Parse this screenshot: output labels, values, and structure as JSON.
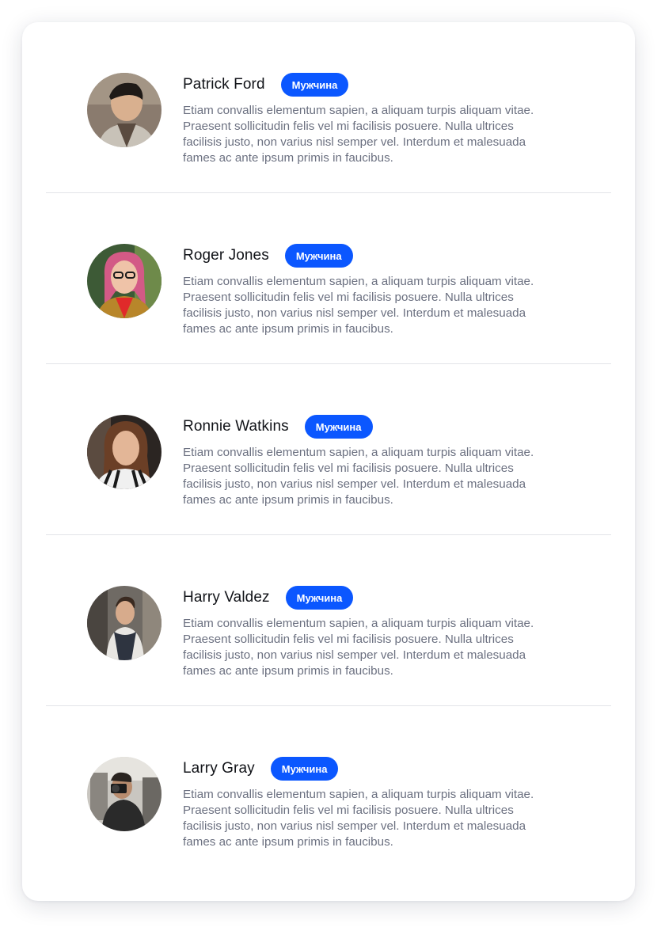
{
  "people": [
    {
      "name": "Patrick Ford",
      "badge": "Мужчина",
      "description": "Etiam convallis elementum sapien, a aliquam turpis aliquam vitae. Praesent sollicitudin felis vel mi facilisis posuere. Nulla ultrices facilisis justo, non varius nisl semper vel. Interdum et malesuada fames ac ante ipsum primis in faucibus."
    },
    {
      "name": "Roger Jones",
      "badge": "Мужчина",
      "description": "Etiam convallis elementum sapien, a aliquam turpis aliquam vitae. Praesent sollicitudin felis vel mi facilisis posuere. Nulla ultrices facilisis justo, non varius nisl semper vel. Interdum et malesuada fames ac ante ipsum primis in faucibus."
    },
    {
      "name": "Ronnie Watkins",
      "badge": "Мужчина",
      "description": "Etiam convallis elementum sapien, a aliquam turpis aliquam vitae. Praesent sollicitudin felis vel mi facilisis posuere. Nulla ultrices facilisis justo, non varius nisl semper vel. Interdum et malesuada fames ac ante ipsum primis in faucibus."
    },
    {
      "name": "Harry Valdez",
      "badge": "Мужчина",
      "description": "Etiam convallis elementum sapien, a aliquam turpis aliquam vitae. Praesent sollicitudin felis vel mi facilisis posuere. Nulla ultrices facilisis justo, non varius nisl semper vel. Interdum et malesuada fames ac ante ipsum primis in faucibus."
    },
    {
      "name": "Larry Gray",
      "badge": "Мужчина",
      "description": "Etiam convallis elementum sapien, a aliquam turpis aliquam vitae. Praesent sollicitudin felis vel mi facilisis posuere. Nulla ultrices facilisis justo, non varius nisl semper vel. Interdum et malesuada fames ac ante ipsum primis in faucibus."
    }
  ],
  "colors": {
    "badge_background": "#0b57ff",
    "name_text": "#111318",
    "description_text": "#6b7080",
    "divider": "#e2e4e8"
  }
}
